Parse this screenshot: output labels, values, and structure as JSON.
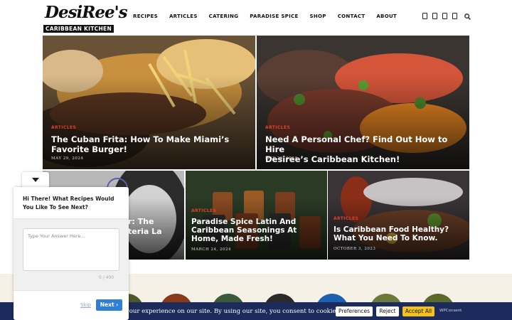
{
  "site": {
    "logo_script": "DesiRee's",
    "logo_bar": "CARIBBEAN KITCHEN"
  },
  "nav": [
    "RECIPES",
    "ARTICLES",
    "CATERING",
    "PARADISE SPICE",
    "SHOP",
    "CONTACT",
    "ABOUT"
  ],
  "social_icons": [
    "facebook-icon",
    "instagram-icon",
    "pinterest-icon",
    "youtube-icon"
  ],
  "posts": [
    {
      "category": "ARTICLES",
      "title_line1": "The Cuban Frita: How To Make Miami’s",
      "title_line2": "Favorite Burger!",
      "date": "MAY 29, 2024"
    },
    {
      "category": "ARTICLES",
      "title_line1": "Need A Personal Chef? Find Out How to Hire",
      "title_line2": "Desiree’s Caribbean Kitchen!",
      "date": "MAY 28, 2024"
    },
    {
      "title_line1": "r: The",
      "title_line2": "teria La"
    },
    {
      "category": "ARTICLES",
      "title_line1": "Paradise Spice Latin And",
      "title_line2": "Caribbean Seasonings At",
      "title_line3": "Home, Made Fresh!",
      "date": "MARCH 24, 2024"
    },
    {
      "category": "ARTICLES",
      "title_line1": "Is Caribbean Food Healthy?",
      "title_line2": "What You Need To Know.",
      "date": "OCTOBER 3, 2023"
    }
  ],
  "cookie": {
    "text": "your experience on our site. By using our site, you consent to cookies.",
    "preferences": "Preferences",
    "reject": "Reject",
    "accept": "Accept All",
    "brand": "WPConsent"
  },
  "chat": {
    "question": "Hi There! What Recipes Would You Like To See Next?",
    "placeholder": "Type Your Answer Here...",
    "counter": "0 / 400",
    "skip": "Skip",
    "next": "Next ›"
  },
  "colors": {
    "accent_red": "#e0412b",
    "cookie_bg": "#1c2a5c",
    "accept_yellow": "#f4c21b",
    "next_blue": "#2f7fd6"
  }
}
